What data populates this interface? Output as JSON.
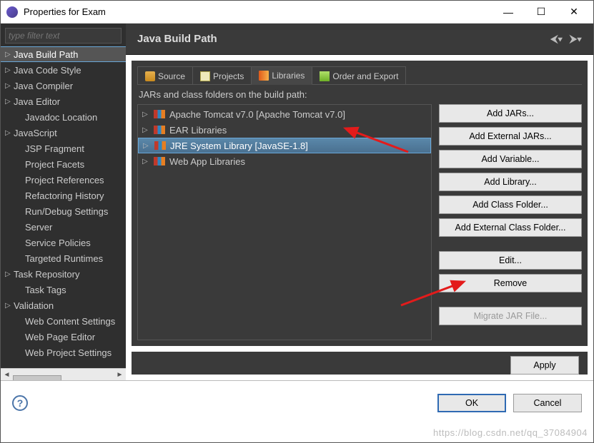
{
  "window": {
    "title": "Properties for Exam"
  },
  "sidebar": {
    "filter_placeholder": "type filter text",
    "items": [
      {
        "label": "Java Build Path",
        "expandable": true,
        "selected": true,
        "indent": false
      },
      {
        "label": "Java Code Style",
        "expandable": true,
        "indent": false
      },
      {
        "label": "Java Compiler",
        "expandable": true,
        "indent": false
      },
      {
        "label": "Java Editor",
        "expandable": true,
        "indent": false
      },
      {
        "label": "Javadoc Location",
        "expandable": false,
        "indent": true
      },
      {
        "label": "JavaScript",
        "expandable": true,
        "indent": false
      },
      {
        "label": "JSP Fragment",
        "expandable": false,
        "indent": true
      },
      {
        "label": "Project Facets",
        "expandable": false,
        "indent": true
      },
      {
        "label": "Project References",
        "expandable": false,
        "indent": true
      },
      {
        "label": "Refactoring History",
        "expandable": false,
        "indent": true
      },
      {
        "label": "Run/Debug Settings",
        "expandable": false,
        "indent": true
      },
      {
        "label": "Server",
        "expandable": false,
        "indent": true
      },
      {
        "label": "Service Policies",
        "expandable": false,
        "indent": true
      },
      {
        "label": "Targeted Runtimes",
        "expandable": false,
        "indent": true
      },
      {
        "label": "Task Repository",
        "expandable": true,
        "indent": false
      },
      {
        "label": "Task Tags",
        "expandable": false,
        "indent": true
      },
      {
        "label": "Validation",
        "expandable": true,
        "indent": false
      },
      {
        "label": "Web Content Settings",
        "expandable": false,
        "indent": true
      },
      {
        "label": "Web Page Editor",
        "expandable": false,
        "indent": true
      },
      {
        "label": "Web Project Settings",
        "expandable": false,
        "indent": true
      }
    ]
  },
  "panel": {
    "title": "Java Build Path",
    "tabs": [
      {
        "label": "Source",
        "icon": "source"
      },
      {
        "label": "Projects",
        "icon": "projects"
      },
      {
        "label": "Libraries",
        "icon": "libraries",
        "active": true
      },
      {
        "label": "Order and Export",
        "icon": "order"
      }
    ],
    "subhead": "JARs and class folders on the build path:",
    "libraries": [
      {
        "label": "Apache Tomcat v7.0 [Apache Tomcat v7.0]"
      },
      {
        "label": "EAR Libraries"
      },
      {
        "label": "JRE System Library [JavaSE-1.8]",
        "selected": true
      },
      {
        "label": "Web App Libraries"
      }
    ],
    "buttons": {
      "add_jars": "Add JARs...",
      "add_ext_jars": "Add External JARs...",
      "add_variable": "Add Variable...",
      "add_library": "Add Library...",
      "add_class_folder": "Add Class Folder...",
      "add_ext_class_folder": "Add External Class Folder...",
      "edit": "Edit...",
      "remove": "Remove",
      "migrate": "Migrate JAR File..."
    },
    "apply": "Apply"
  },
  "footer": {
    "ok": "OK",
    "cancel": "Cancel"
  },
  "watermark": "https://blog.csdn.net/qq_37084904"
}
